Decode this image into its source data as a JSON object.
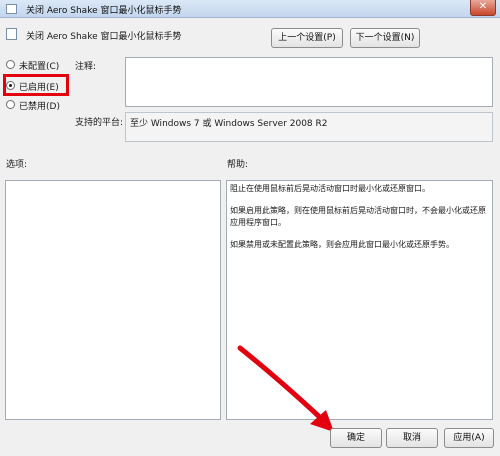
{
  "window": {
    "title": "关闭 Aero Shake 窗口最小化鼠标手势",
    "close_glyph": "✕"
  },
  "header": {
    "title": "关闭 Aero Shake 窗口最小化鼠标手势",
    "prev_label": "上一个设置(P)",
    "next_label": "下一个设置(N)"
  },
  "state": {
    "options": [
      {
        "label": "未配置(C)",
        "checked": false
      },
      {
        "label": "已启用(E)",
        "checked": true
      },
      {
        "label": "已禁用(D)",
        "checked": false
      }
    ]
  },
  "fields": {
    "comment_label": "注释:",
    "comment_value": "",
    "platform_label": "支持的平台:",
    "platform_value": "至少 Windows 7 或 Windows Server 2008 R2"
  },
  "panes": {
    "options_label": "选项:",
    "help_label": "帮助:",
    "help_paragraphs": [
      "阻止在使用鼠标前后晃动活动窗口时最小化或还原窗口。",
      "如果启用此策略，则在使用鼠标前后晃动活动窗口时，不会最小化或还原应用程序窗口。",
      "如果禁用或未配置此策略，则会应用此窗口最小化或还原手势。"
    ]
  },
  "footer": {
    "ok_label": "确定",
    "cancel_label": "取消",
    "apply_label": "应用(A)"
  },
  "colors": {
    "highlight": "#e3000f",
    "arrow": "#e3000f"
  }
}
